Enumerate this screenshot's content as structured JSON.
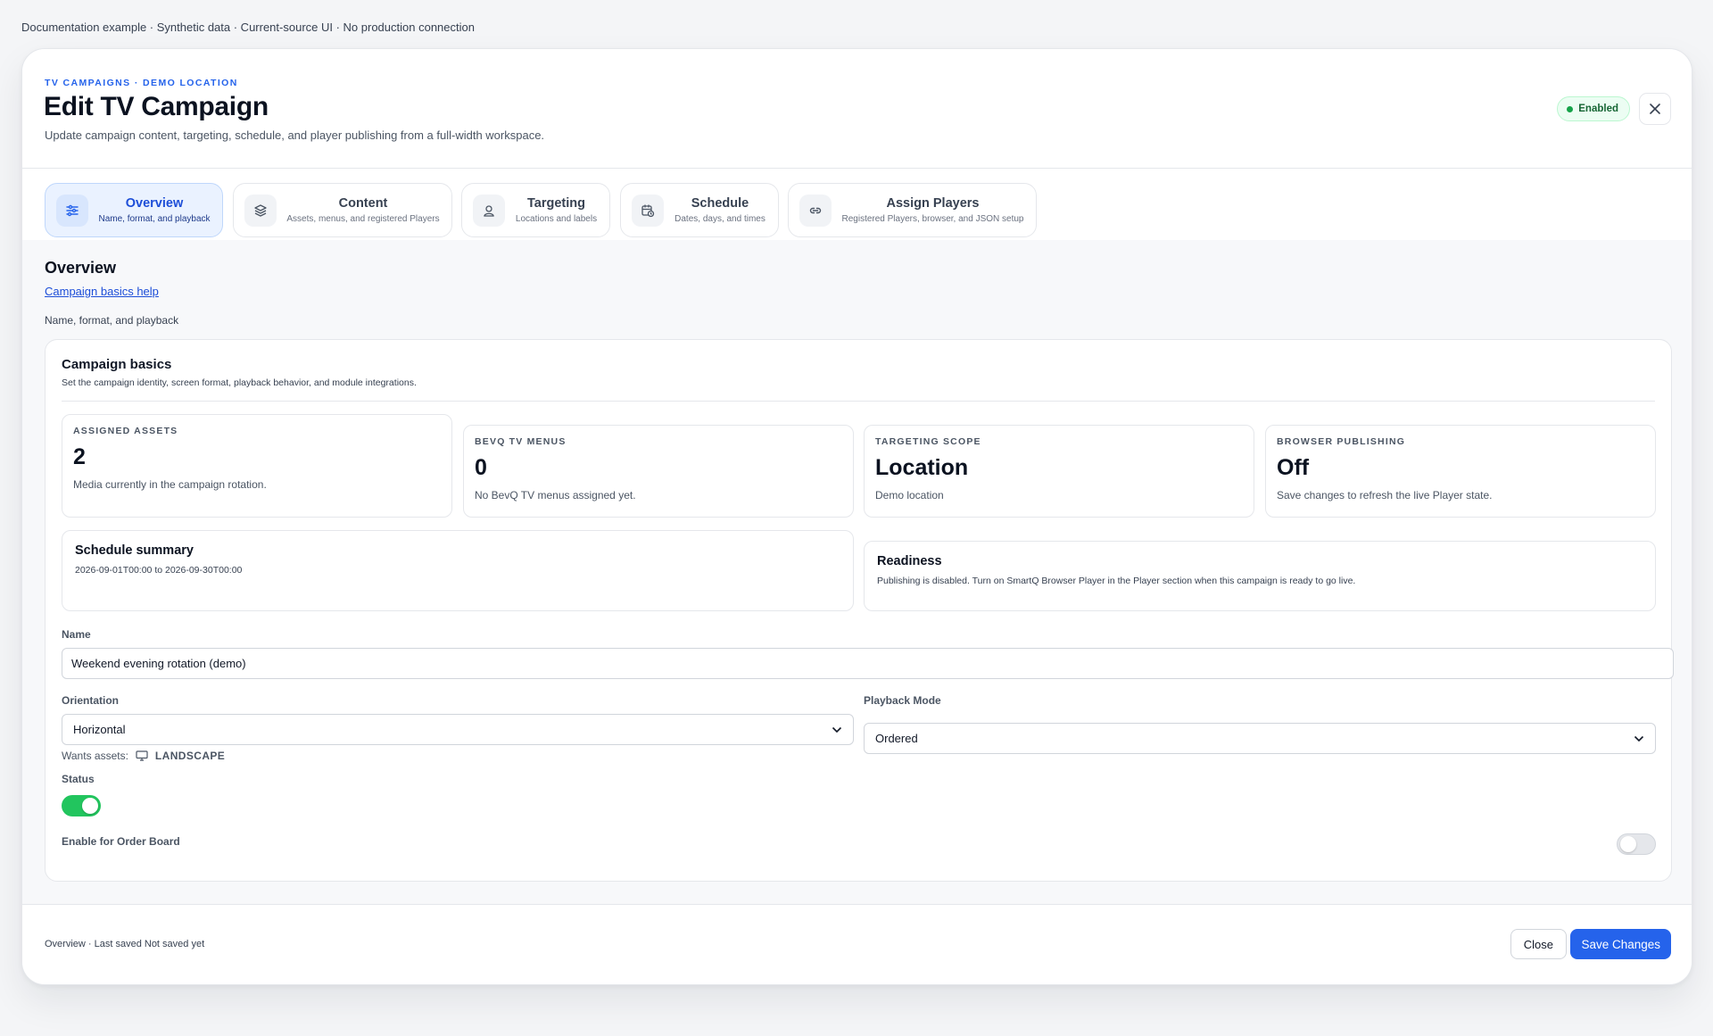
{
  "top_note": "Documentation example · Synthetic data · Current-source UI · No production connection",
  "header": {
    "eyebrow": "TV CAMPAIGNS · DEMO LOCATION",
    "title": "Edit TV Campaign",
    "subtitle": "Update campaign content, targeting, schedule, and player publishing from a full-width workspace.",
    "status_badge": "Enabled",
    "close_icon": "close-icon"
  },
  "tabs": [
    {
      "label": "Overview",
      "sub": "Name, format, and playback",
      "icon": "sliders-icon",
      "active": true
    },
    {
      "label": "Content",
      "sub": "Assets, menus, and registered Players",
      "icon": "layers-icon",
      "active": false
    },
    {
      "label": "Targeting",
      "sub": "Locations and labels",
      "icon": "location-user-icon",
      "active": false
    },
    {
      "label": "Schedule",
      "sub": "Dates, days, and times",
      "icon": "calendar-clock-icon",
      "active": false
    },
    {
      "label": "Assign Players",
      "sub": "Registered Players, browser, and JSON setup",
      "icon": "link-icon",
      "active": false
    }
  ],
  "section": {
    "title": "Overview",
    "help_link": "Campaign basics help",
    "subtitle": "Name, format, and playback"
  },
  "card": {
    "title": "Campaign basics",
    "subtitle": "Set the campaign identity, screen format, playback behavior, and module integrations."
  },
  "stats": [
    {
      "label": "ASSIGNED ASSETS",
      "value": "2",
      "desc": "Media currently in the campaign rotation."
    },
    {
      "label": "BEVQ TV MENUS",
      "value": "0",
      "desc": "No BevQ TV menus assigned yet."
    },
    {
      "label": "TARGETING SCOPE",
      "value": "Location",
      "desc": "Demo location"
    },
    {
      "label": "BROWSER PUBLISHING",
      "value": "Off",
      "desc": "Save changes to refresh the live Player state."
    }
  ],
  "schedule_summary": {
    "title": "Schedule summary",
    "desc": "2026-09-01T00:00 to 2026-09-30T00:00"
  },
  "readiness": {
    "title": "Readiness",
    "desc": "Publishing is disabled. Turn on SmartQ Browser Player in the Player section when this campaign is ready to go live."
  },
  "form": {
    "name_label": "Name",
    "name_value": "Weekend evening rotation (demo)",
    "orientation_label": "Orientation",
    "orientation_value": "Horizontal",
    "playback_label": "Playback Mode",
    "playback_value": "Ordered",
    "wants_label": "Wants assets:",
    "wants_value": "LANDSCAPE",
    "status_label": "Status",
    "status_on": true,
    "order_board_label": "Enable for Order Board",
    "order_board_on": false
  },
  "footer": {
    "status": "Overview · Last saved Not saved yet",
    "close_label": "Close",
    "save_label": "Save Changes"
  },
  "colors": {
    "accent": "#2563eb",
    "toggle_on": "#22c55e",
    "badge_bg": "#ecfdf3"
  }
}
